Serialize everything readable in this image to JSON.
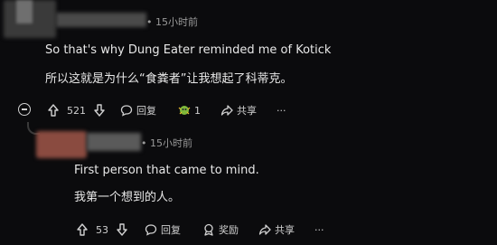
{
  "comment1": {
    "time": "15小时前",
    "text_en": "So that's why Dung Eater reminded me of Kotick",
    "text_zh": "所以这就是为什么“食粪者”让我想起了科蒂克。",
    "actions": {
      "upvotes": "521",
      "reply_label": "回复",
      "award_count": "1",
      "share_label": "共享",
      "more_label": "···"
    }
  },
  "comment2": {
    "time": "15小时前",
    "text_en": "First person that came to mind.",
    "text_zh": "我第一个想到的人。",
    "actions": {
      "upvotes": "53",
      "reply_label": "回复",
      "award_label": "奖励",
      "share_label": "共享",
      "more_label": "···"
    }
  }
}
